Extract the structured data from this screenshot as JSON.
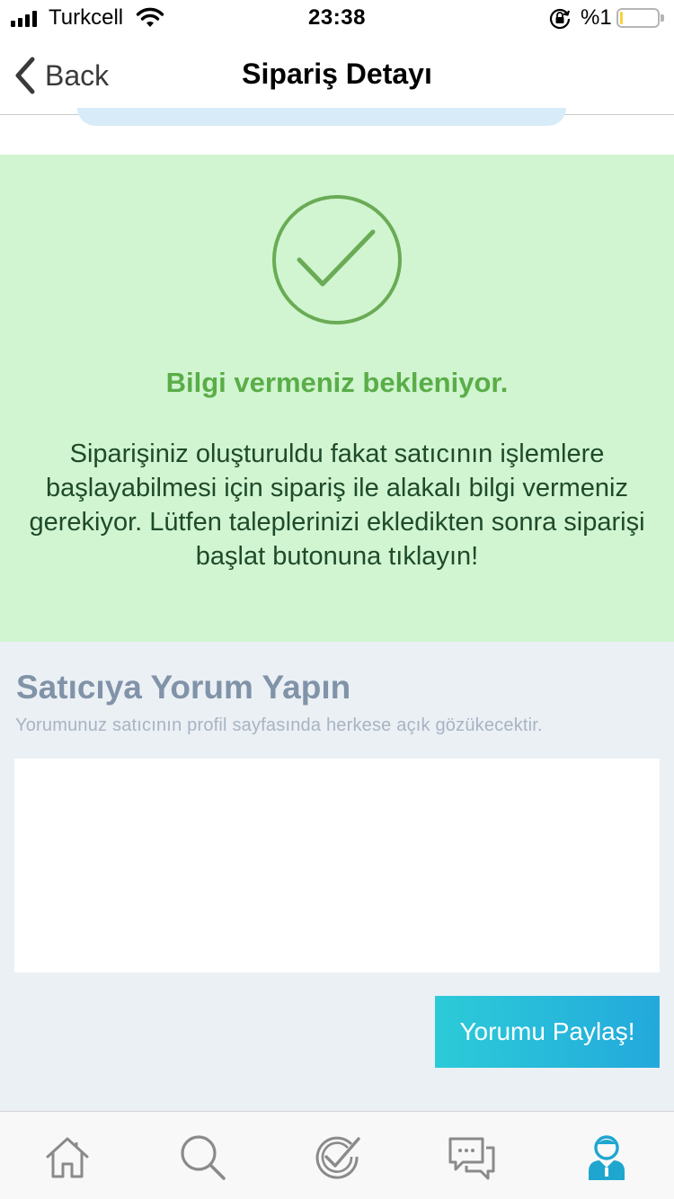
{
  "status_bar": {
    "carrier": "Turkcell",
    "time": "23:38",
    "battery_percent": "%1",
    "battery_level": 0.01
  },
  "nav": {
    "back_label": "Back",
    "title": "Sipariş Detayı"
  },
  "info": {
    "heading": "Bilgi vermeniz bekleniyor.",
    "body": "Siparişiniz oluşturuldu fakat satıcının işlemlere başlayabilmesi için sipariş ile alakalı bilgi vermeniz gerekiyor. Lütfen taleplerinizi ekledikten sonra siparişi başlat butonuna tıklayın!",
    "accent_color": "#5aad48",
    "background_color": "#d0f5d0"
  },
  "comment": {
    "title": "Satıcıya Yorum Yapın",
    "subtitle": "Yorumunuz satıcının profil sayfasında herkese açık gözükecektir.",
    "input_value": "",
    "input_placeholder": "",
    "share_button": "Yorumu Paylaş!"
  },
  "tab_bar": {
    "items": [
      {
        "icon": "home-icon",
        "active": false
      },
      {
        "icon": "search-icon",
        "active": false
      },
      {
        "icon": "check-badge-icon",
        "active": false
      },
      {
        "icon": "chat-icon",
        "active": false
      },
      {
        "icon": "profile-icon",
        "active": true
      }
    ],
    "active_color": "#1fa6cf",
    "inactive_color": "#8a8a8a"
  }
}
